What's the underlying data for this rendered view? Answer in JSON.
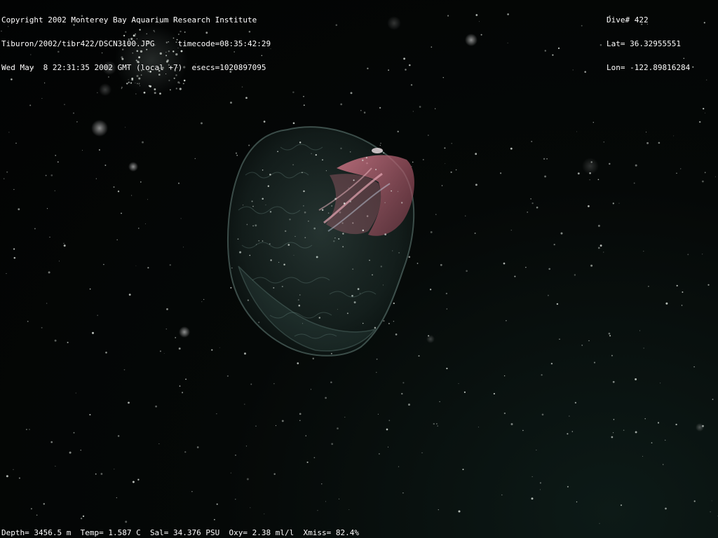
{
  "overlay": {
    "top_left": {
      "copyright": "Copyright 2002 Monterey Bay Aquarium Research Institute",
      "file_path": "Tiburon/2002/tibr422/DSCN3100.JPG",
      "timecode": "timecode=08:35:42:29",
      "datetime": "Wed May  8 22:31:35 2002 GMT (local +7)",
      "esecs": "esecs=1020897095"
    },
    "top_right": {
      "dive": "Dive# 422",
      "lat": "Lat= 36.32955551",
      "lon": "Lon= -122.89816284"
    },
    "bottom": {
      "depth": "Depth= 3456.5 m",
      "temp": "Temp= 1.587 C",
      "sal": "Sal= 34.376 PSU",
      "oxy": "Oxy= 2.38 ml/l",
      "xmiss": "Xmiss= 82.4%"
    }
  },
  "colors": {
    "text": "#ffffff",
    "background": "#030505",
    "organism_body": "#8fb5ad",
    "organism_accent": "#c0606e"
  }
}
